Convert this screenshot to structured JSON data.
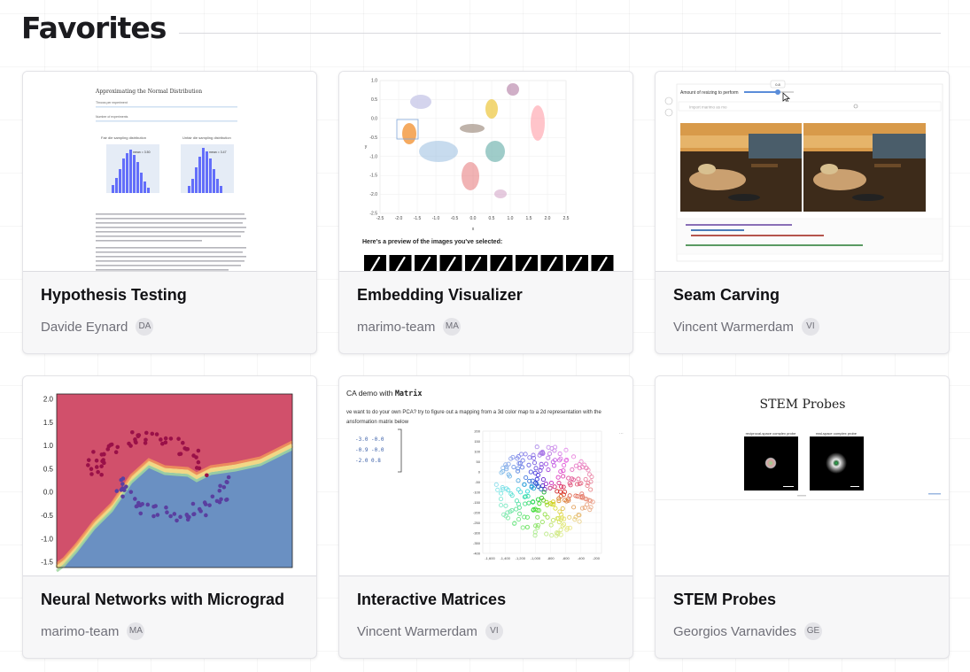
{
  "page": {
    "title": "Favorites"
  },
  "cards": [
    {
      "title": "Hypothesis Testing",
      "author": "Davide Eynard",
      "initials": "DA",
      "thumb": {
        "heading": "Approximating the Normal Distribution",
        "slider1": "Throws per experiment",
        "slider2": "Number of experiments",
        "left_title": "Fair die sampling distribution",
        "right_title": "Unfair die sampling distribution",
        "left_stat": "mean = 3.50",
        "right_stat": "mean = 3.47"
      }
    },
    {
      "title": "Embedding Visualizer",
      "author": "marimo-team",
      "initials": "MA",
      "thumb": {
        "preview_label": "Here's a preview of the images you've selected:",
        "y_ticks": [
          "1.0",
          "0.5",
          "0.0",
          "-0.5",
          "-1.0",
          "-1.5",
          "-2.0",
          "-2.5"
        ],
        "x_ticks": [
          "-2.5",
          "-2.0",
          "-1.5",
          "-1.0",
          "-0.5",
          "0.0",
          "0.5",
          "1.0",
          "1.5",
          "2.0",
          "2.5"
        ],
        "x_label": "x",
        "y_label": "y"
      }
    },
    {
      "title": "Seam Carving",
      "author": "Vincent Warmerdam",
      "initials": "VI",
      "thumb": {
        "slider_label": "Amount of resizing to perform",
        "slider_value": "0.8",
        "search_placeholder": "Import marimo as mo"
      }
    },
    {
      "title": "Neural Networks with Micrograd",
      "author": "marimo-team",
      "initials": "MA",
      "thumb": {
        "y_ticks": [
          "2.0",
          "1.5",
          "1.0",
          "0.5",
          "0.0",
          "-0.5",
          "-1.0",
          "-1.5"
        ]
      }
    },
    {
      "title": "Interactive Matrices",
      "author": "Vincent Warmerdam",
      "initials": "VI",
      "thumb": {
        "heading_pre": "CA demo with ",
        "heading_code": "Matrix",
        "desc1": "ve want to do your own PCA? try to figure out a mapping from a 3d color map to a 2d representation with the",
        "desc2": "ansformation matrix below",
        "matrix_rows": [
          "-3.0  -0.0",
          "-0.9  -0.0",
          "-2.0   0.8"
        ],
        "y_ticks": [
          "200",
          "150",
          "100",
          "50",
          "0",
          "-50",
          "-100",
          "-150",
          "-200",
          "-250",
          "-300",
          "-350",
          "-400"
        ],
        "x_ticks": [
          "-1,600",
          "-1,400",
          "-1,200",
          "-1,000",
          "-800",
          "-600",
          "-400",
          "-200"
        ]
      }
    },
    {
      "title": "STEM Probes",
      "author": "Georgios Varnavides",
      "initials": "GE",
      "thumb": {
        "heading": "STEM Probes",
        "left_label": "reciprocal-space complex probe",
        "right_label": "real-space complex probe"
      }
    }
  ]
}
